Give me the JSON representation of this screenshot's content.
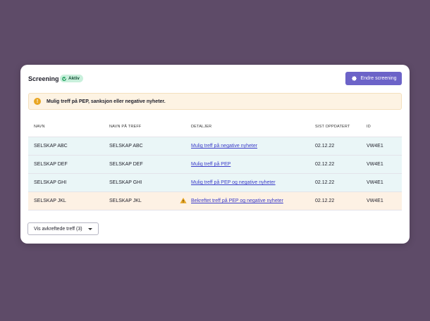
{
  "header": {
    "title": "Screening",
    "status_badge": "Aktiv",
    "edit_button": "Endre screening"
  },
  "alert": {
    "icon": "!",
    "message": "Mulig treff på PEP, sanksjon eller negative nyheter."
  },
  "table": {
    "columns": [
      "NAVN",
      "NAVN PÅ TREFF",
      "DETALJER",
      "SIST OPPDATERT",
      "ID"
    ],
    "rows": [
      {
        "name": "SELSKAP ABC",
        "match_name": "SELSKAP ABC",
        "details": "Mulig treff på negative nyheter",
        "updated": "02.12.22",
        "id": "VW4E1"
      },
      {
        "name": "SELSKAP DEF",
        "match_name": "SELSKAP DEF",
        "details": "Mulig treff på PEP",
        "updated": "02.12.22",
        "id": "VW4E1"
      },
      {
        "name": "SELSKAP GHI",
        "match_name": "SELSKAP GHI",
        "details": "Mulig treff på PEP og negative nyheter",
        "updated": "02.12.22",
        "id": "VW4E1"
      },
      {
        "name": "SELSKAP JKL",
        "match_name": "SELSKAP JKL",
        "details": "Bekreftet treff på PEP og negative nyheter",
        "updated": "02.12.22",
        "id": "VW4E1",
        "warning": true
      }
    ]
  },
  "footer": {
    "show_rejected_button": "Vis avkreftede treff (3)"
  },
  "colors": {
    "background": "#5e4b68",
    "primary": "#6c63c8",
    "badge_bg": "#c9f0dc",
    "alert_bg": "#fdf3e3",
    "row_info_bg": "#eaf6f7",
    "row_warn_bg": "#fdf1e4",
    "link": "#3a3cc9"
  }
}
